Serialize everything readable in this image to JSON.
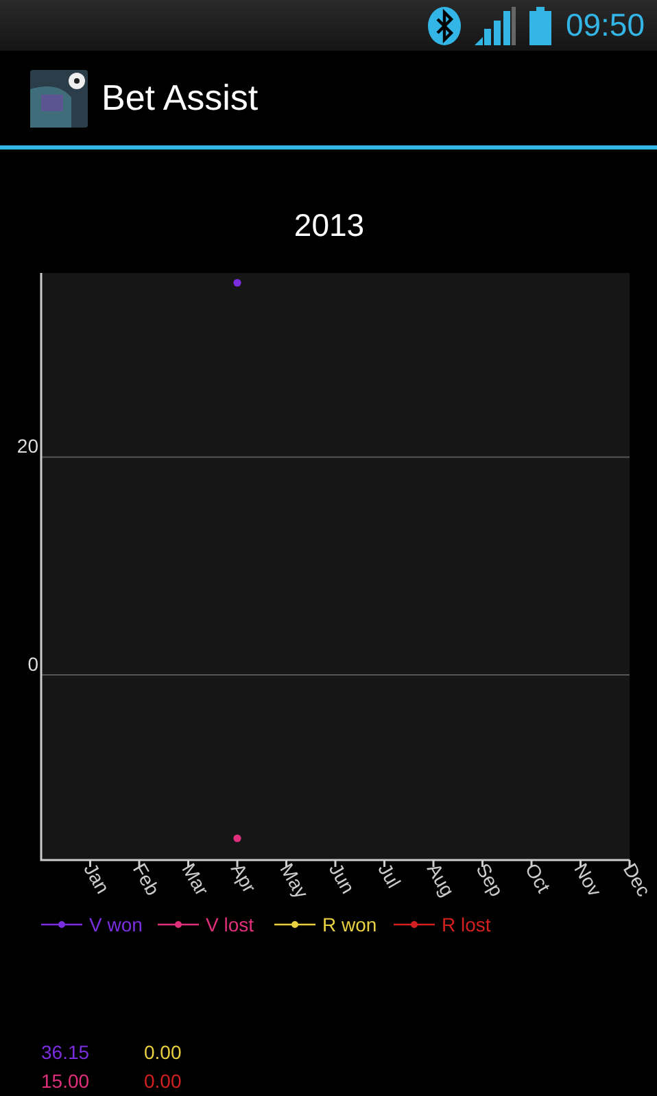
{
  "status_bar": {
    "time": "09:50"
  },
  "action_bar": {
    "title": "Bet Assist"
  },
  "chart": {
    "chart_data": {
      "type": "line",
      "title": "2013",
      "categories": [
        "Jan",
        "Feb",
        "Mar",
        "Apr",
        "May",
        "Jun",
        "Jul",
        "Aug",
        "Sep",
        "Oct",
        "Nov",
        "Dec"
      ],
      "ylim": [
        -17,
        36.9
      ],
      "yticks": [
        0,
        20
      ],
      "legend": true,
      "series": [
        {
          "name": "V won",
          "color": "#7a2ee0",
          "marker": "circle",
          "values": [
            null,
            null,
            null,
            36,
            null,
            null,
            null,
            null,
            null,
            null,
            null,
            null
          ]
        },
        {
          "name": "V lost",
          "color": "#e0307c",
          "marker": "circle",
          "values": [
            null,
            null,
            null,
            -15,
            null,
            null,
            null,
            null,
            null,
            null,
            null,
            null
          ]
        },
        {
          "name": "R won",
          "color": "#e8d040",
          "marker": "circle",
          "values": [
            null,
            null,
            null,
            null,
            null,
            null,
            null,
            null,
            null,
            null,
            null,
            null
          ]
        },
        {
          "name": "R lost",
          "color": "#d42020",
          "marker": "circle",
          "values": [
            null,
            null,
            null,
            null,
            null,
            null,
            null,
            null,
            null,
            null,
            null,
            null
          ]
        }
      ]
    }
  },
  "totals": [
    {
      "value": "36.15",
      "color": "#7a2ee0"
    },
    {
      "value": "0.00",
      "color": "#e8d040"
    },
    {
      "value": "15.00",
      "color": "#e0307c"
    },
    {
      "value": "0.00",
      "color": "#d42020"
    }
  ]
}
